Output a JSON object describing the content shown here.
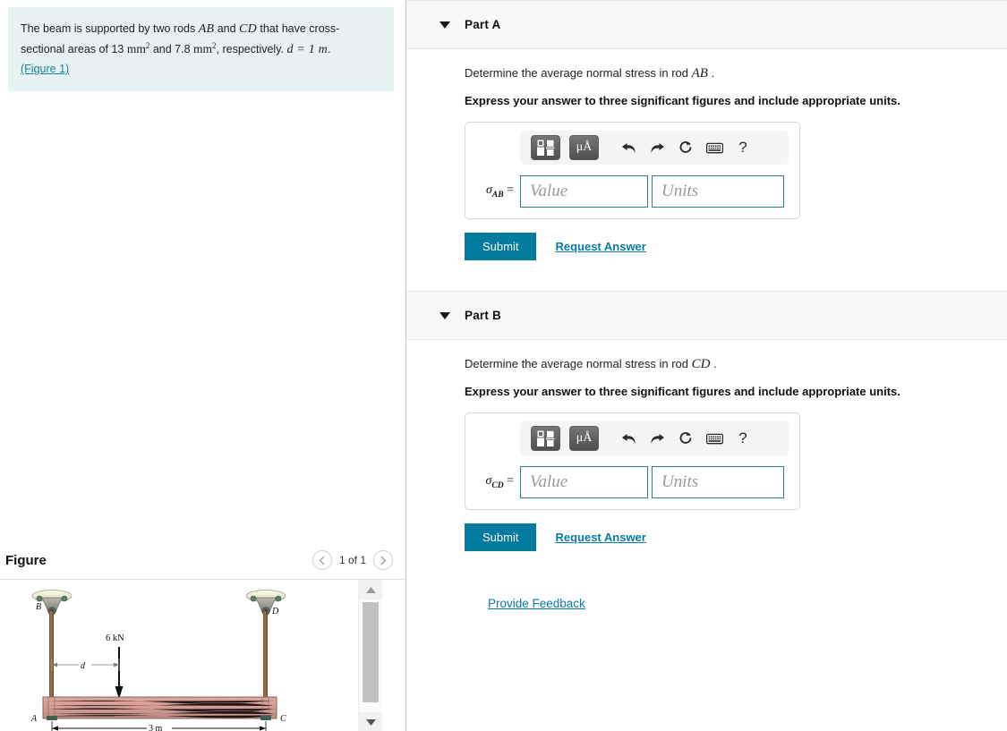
{
  "problem": {
    "text_part1": "The beam is supported by two rods ",
    "rod1": "AB",
    "text_part2": " and ",
    "rod2": "CD",
    "text_part3": " that have cross-sectional areas of 13 ",
    "unit1": "mm",
    "exp1": "2",
    "text_part4": " and 7.8 ",
    "unit2": "mm",
    "exp2": "2",
    "text_part5": ", respectively. ",
    "given": "d = 1 m",
    "period": ".",
    "figure_link": "(Figure 1)",
    "figure_link_text": "Figure 1"
  },
  "figure": {
    "title": "Figure",
    "counter": "1 of 1",
    "prev_icon": "chevron-left-icon",
    "next_icon": "chevron-right-icon",
    "scroll_up_icon": "triangle-up-icon",
    "scroll_down_icon": "triangle-down-icon",
    "labels": {
      "B": "B",
      "D": "D",
      "A": "A",
      "C": "C",
      "load": "6 kN",
      "dim_d": "d",
      "span": "3 m"
    }
  },
  "parts": [
    {
      "title": "Part A",
      "question_prefix": "Determine the average normal stress in rod ",
      "question_var": "AB",
      "question_suffix": ".",
      "instruction": "Express your answer to three significant figures and include appropriate units.",
      "variable_main": "σ",
      "variable_sub": "AB",
      "variable_eq": "=",
      "value_placeholder": "Value",
      "units_placeholder": "Units",
      "value": "",
      "units": "",
      "submit_label": "Submit",
      "request_label": "Request Answer"
    },
    {
      "title": "Part B",
      "question_prefix": "Determine the average normal stress in rod ",
      "question_var": "CD",
      "question_suffix": ".",
      "instruction": "Express your answer to three significant figures and include appropriate units.",
      "variable_main": "σ",
      "variable_sub": "CD",
      "variable_eq": "=",
      "value_placeholder": "Value",
      "units_placeholder": "Units",
      "value": "",
      "units": "",
      "submit_label": "Submit",
      "request_label": "Request Answer"
    }
  ],
  "toolbar": {
    "template_icon": "math-template-icon",
    "units_label": "μÅ",
    "undo_icon": "undo-arrow-icon",
    "redo_icon": "redo-arrow-icon",
    "reset_icon": "reset-circle-icon",
    "keyboard_icon": "keyboard-icon",
    "help_icon": "question-mark-icon",
    "help_label": "?"
  },
  "feedback": {
    "label": "Provide Feedback"
  },
  "colors": {
    "accent": "#027b9e",
    "link": "#0a7aa6",
    "statement_bg": "#e7f3f3",
    "part_header_bg": "#f8f8f8",
    "field_border": "#2d7f93",
    "divider": "#b8cdd9"
  }
}
